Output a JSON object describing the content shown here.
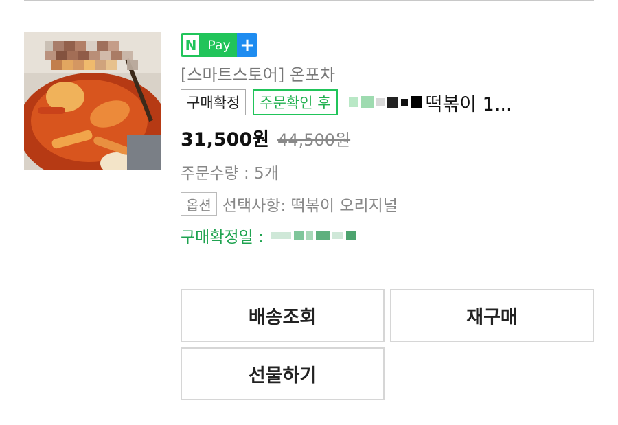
{
  "product": {
    "npay": {
      "n": "N",
      "pay": "Pay",
      "plus": "+"
    },
    "store": "[스마트스토어] 온포차",
    "status_badge": "구매확정",
    "order_badge": "주문확인 후",
    "name": "떡볶이 1...",
    "price": "31,500원",
    "original_price": "44,500원",
    "quantity": "주문수량 : 5개",
    "option_badge": "옵션",
    "option_text": "선택사항: 떡볶이 오리지널",
    "confirm_date_label": "구매확정일 :"
  },
  "actions": {
    "track_delivery": "배송조회",
    "rebuy": "재구매",
    "gift": "선물하기"
  },
  "colors": {
    "accent_green": "#21c45a",
    "confirm_green": "#1fa350",
    "npay_blue": "#1e8cf0"
  }
}
